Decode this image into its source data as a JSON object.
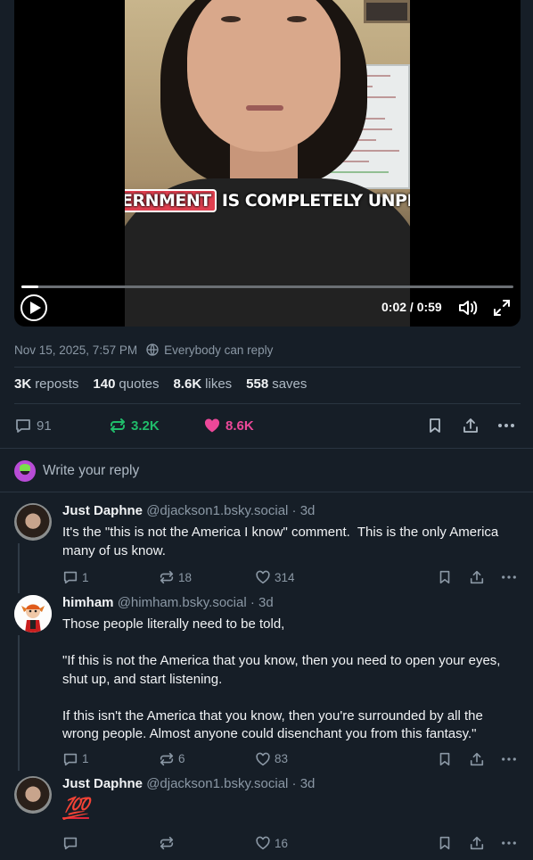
{
  "video": {
    "caption_highlight": "ERNMENT",
    "caption_rest": " IS COMPLETELY UNPRECEDEN",
    "time": "0:02 / 0:59",
    "progress": 0.034
  },
  "post": {
    "date": "Nov 15, 2025, 7:57 PM",
    "reply_setting": "Everybody can reply",
    "stats": {
      "reposts_count": "3K",
      "reposts_label": "reposts",
      "quotes_count": "140",
      "quotes_label": "quotes",
      "likes_count": "8.6K",
      "likes_label": "likes",
      "saves_count": "558",
      "saves_label": "saves"
    },
    "actions": {
      "replies": "91",
      "reposts": "3.2K",
      "likes": "8.6K"
    }
  },
  "composer": {
    "placeholder": "Write your reply"
  },
  "replies": [
    {
      "name": "Just Daphne",
      "handle": "@djackson1.bsky.social",
      "age": "· 3d",
      "text": "It's the \"this is not the America I know\" comment.  This is the only America many of us know.",
      "replies": "1",
      "reposts": "18",
      "likes": "314"
    },
    {
      "name": "himham",
      "handle": "@himham.bsky.social",
      "age": "· 3d",
      "text": "Those people literally need to be told,\n\n\"If this is not the America that you know, then you need to open your eyes, shut up, and start listening.\n\nIf this isn't the America that you know, then you're surrounded by all the wrong people. Almost anyone could disenchant you from this fantasy.\"",
      "replies": "1",
      "reposts": "6",
      "likes": "83"
    },
    {
      "name": "Just Daphne",
      "handle": "@djackson1.bsky.social",
      "age": "· 3d",
      "text": "💯",
      "replies": "",
      "reposts": "",
      "likes": "16"
    }
  ],
  "colors": {
    "background": "#161e27",
    "repost_active": "#20bc6a",
    "like_active": "#ec4899",
    "muted": "#8b98a5"
  }
}
